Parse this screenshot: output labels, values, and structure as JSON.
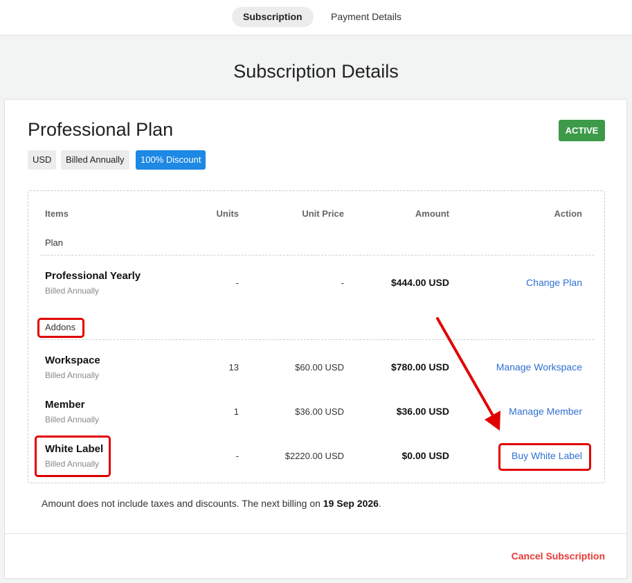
{
  "tabs": [
    {
      "label": "Subscription",
      "active": true
    },
    {
      "label": "Payment Details",
      "active": false
    }
  ],
  "page_title": "Subscription Details",
  "plan": {
    "title": "Professional Plan",
    "status": "ACTIVE",
    "chips": {
      "currency": "USD",
      "billing": "Billed Annually",
      "discount": "100% Discount"
    }
  },
  "table": {
    "headers": {
      "items": "Items",
      "units": "Units",
      "unit_price": "Unit Price",
      "amount": "Amount",
      "action": "Action"
    },
    "plan_section": "Plan",
    "addons_section": "Addons",
    "rows": [
      {
        "name": "Professional Yearly",
        "sub": "Billed Annually",
        "units": "-",
        "unit_price": "-",
        "amount": "$444.00 USD",
        "action": "Change Plan"
      },
      {
        "name": "Workspace",
        "sub": "Billed Annually",
        "units": "13",
        "unit_price": "$60.00 USD",
        "amount": "$780.00 USD",
        "action": "Manage Workspace"
      },
      {
        "name": "Member",
        "sub": "Billed Annually",
        "units": "1",
        "unit_price": "$36.00 USD",
        "amount": "$36.00 USD",
        "action": "Manage Member"
      },
      {
        "name": "White Label",
        "sub": "Billed Annually",
        "units": "-",
        "unit_price": "$2220.00 USD",
        "amount": "$0.00 USD",
        "action": "Buy White Label"
      }
    ]
  },
  "note": {
    "text": "Amount does not include taxes and discounts. The next billing on ",
    "date": "19 Sep 2026",
    "suffix": "."
  },
  "cancel_label": "Cancel Subscription",
  "colors": {
    "status": "#3c9a48",
    "discount": "#1e88e5",
    "link": "#2f6fd1",
    "cancel": "#e53935",
    "annotation": "#e00000"
  }
}
